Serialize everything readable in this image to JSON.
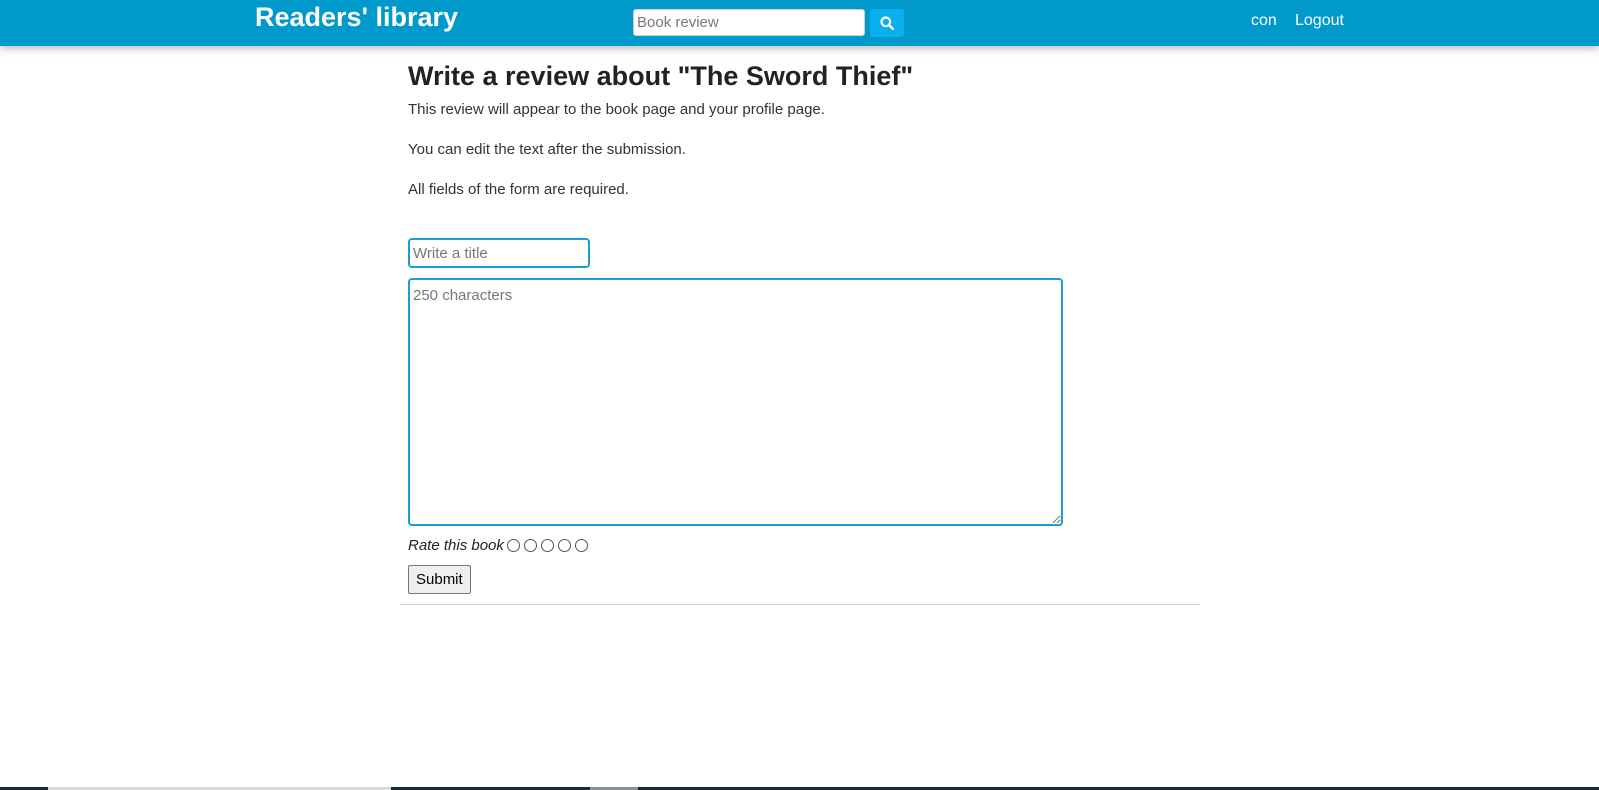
{
  "header": {
    "brand": "Readers' library",
    "search_placeholder": "Book review",
    "search_button_icon": "search-icon",
    "user_link": "con",
    "logout_link": "Logout",
    "brand_color": "#0099cc"
  },
  "main": {
    "title": "Write a review about \"The Sword Thief\"",
    "info": [
      "This review will appear to the book page and your profile page.",
      "You can edit the text after the submission.",
      "All fields of the form are required."
    ],
    "form": {
      "title_placeholder": "Write a title",
      "text_placeholder": "250 characters",
      "rating_label": "Rate this book",
      "rating_options": 5,
      "submit_label": "Submit"
    }
  }
}
